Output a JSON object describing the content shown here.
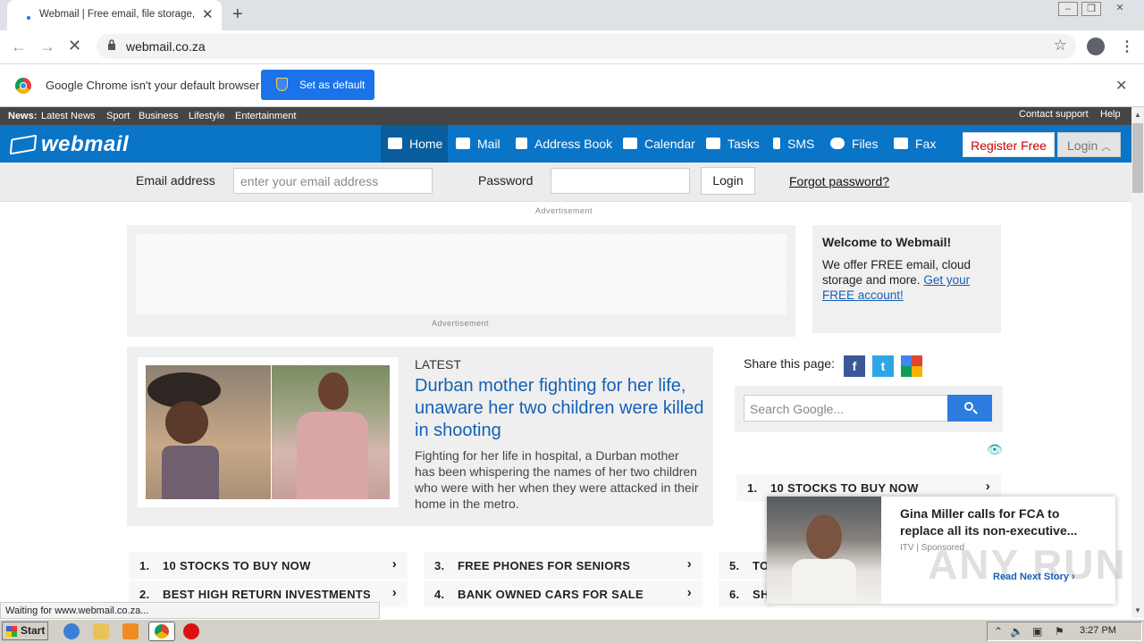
{
  "browser": {
    "tab_title": "Webmail | Free email, file storage, sms",
    "url": "webmail.co.za",
    "infobar_text": "Google Chrome isn't your default browser",
    "set_default_label": "Set as default",
    "status_text": "Waiting for www.webmail.co.za..."
  },
  "topstrip": {
    "news_label": "News:",
    "links": [
      "Latest News",
      "Sport",
      "Business",
      "Lifestyle",
      "Entertainment"
    ],
    "contact": "Contact support",
    "help": "Help"
  },
  "nav": {
    "logo": "webmail",
    "items": [
      "Home",
      "Mail",
      "Address Book",
      "Calendar",
      "Tasks",
      "SMS",
      "Files",
      "Fax"
    ],
    "register": "Register Free",
    "login": "Login"
  },
  "loginbar": {
    "email_label": "Email address",
    "email_placeholder": "enter your email address",
    "password_label": "Password",
    "login_button": "Login",
    "forgot": "Forgot password?"
  },
  "ads": {
    "top_label": "Advertisement",
    "box_label": "Advertisement"
  },
  "welcome": {
    "title": "Welcome to Webmail!",
    "text": "We offer FREE email, cloud storage and more.",
    "link": "Get your FREE account!"
  },
  "news": {
    "kicker": "LATEST",
    "headline": "Durban mother fighting for her life, unaware her two children were killed in shooting",
    "summary": "Fighting for her life in hospital, a Durban mother has been whispering the names of her two children who were with her when they were attacked in their home in the metro."
  },
  "sidebar": {
    "share_label": "Share this page:",
    "search_placeholder": "Search Google...",
    "stock_num": "1.",
    "stock_text": "10 STOCKS TO BUY NOW"
  },
  "links": [
    {
      "num": "1.",
      "text": "10 STOCKS TO BUY NOW"
    },
    {
      "num": "3.",
      "text": "FREE PHONES FOR SENIORS"
    },
    {
      "num": "5.",
      "text": "TO"
    },
    {
      "num": "2.",
      "text": "BEST HIGH RETURN INVESTMENTS"
    },
    {
      "num": "4.",
      "text": "BANK OWNED CARS FOR SALE"
    },
    {
      "num": "6.",
      "text": "SH"
    }
  ],
  "popup": {
    "headline": "Gina Miller calls for FCA to replace all its non-executive...",
    "source": "ITV | Sponsored",
    "next": "Read Next Story ›",
    "watermark": "ANY RUN"
  },
  "taskbar": {
    "start": "Start",
    "clock": "3:27 PM"
  }
}
